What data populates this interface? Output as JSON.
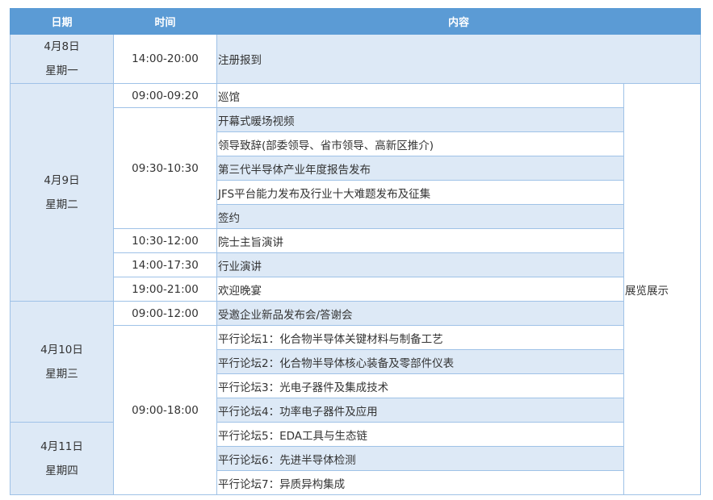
{
  "headers": {
    "date": "日期",
    "time": "时间",
    "content": "内容"
  },
  "days": [
    {
      "date": "4月8日",
      "weekday": "星期一"
    },
    {
      "date": "4月9日",
      "weekday": "星期二"
    },
    {
      "date": "4月10日",
      "weekday": "星期三"
    },
    {
      "date": "4月11日",
      "weekday": "星期四"
    }
  ],
  "times": [
    "14:00-20:00",
    "09:00-09:20",
    "09:30-10:30",
    "10:30-12:00",
    "14:00-17:30",
    "19:00-21:00",
    "09:00-12:00",
    "09:00-18:00"
  ],
  "items": [
    "注册报到",
    "巡馆",
    "开幕式暖场视频",
    "领导致辞(部委领导、省市领导、高新区推介)",
    "第三代半导体产业年度报告发布",
    "JFS平台能力发布及行业十大难题发布及征集",
    "签约",
    "院士主旨演讲",
    "行业演讲",
    "欢迎晚宴",
    "受邀企业新品发布会/答谢会",
    "平行论坛1：化合物半导体关键材料与制备工艺",
    "平行论坛2：化合物半导体核心装备及零部件仪表",
    "平行论坛3：光电子器件及集成技术",
    "平行论坛4：功率电子器件及应用",
    "平行论坛5：EDA工具与生态链",
    "平行论坛6：先进半导体检测",
    "平行论坛7：异质异构集成"
  ],
  "exhibition": "展览展示"
}
